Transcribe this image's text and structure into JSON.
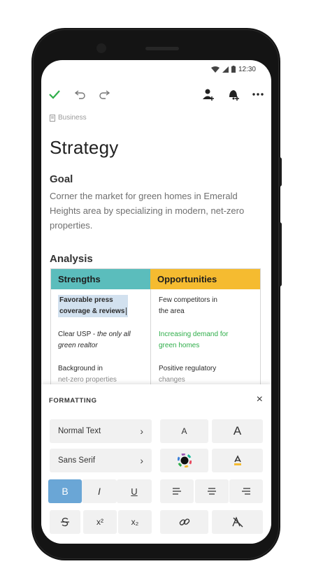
{
  "status": {
    "time": "12:30"
  },
  "toolbar": {
    "done": "done-check",
    "undo": "undo-arrow",
    "redo": "redo-arrow",
    "share": "add-person",
    "notify": "bell-plus",
    "more": "more-dots"
  },
  "note": {
    "breadcrumb": "Business",
    "title": "Strategy",
    "goal_heading": "Goal",
    "goal_text": "Corner the market for green homes in Emerald Heights area by specializing in modern, net-zero properties.",
    "analysis_heading": "Analysis"
  },
  "table": {
    "headers": [
      "Strengths",
      "Opportunities"
    ],
    "strengths": [
      {
        "line1": "Favorable press",
        "line2": "coverage & reviews"
      },
      {
        "line1a": "Clear USP - ",
        "line1b": "the only all",
        "line2": "green realtor"
      },
      {
        "line1": "Background in",
        "line2": "net-zero properties"
      }
    ],
    "opportunities": [
      {
        "line1": "Few competitors in",
        "line2": "the area"
      },
      {
        "line1": "Increasing demand for",
        "line2": "green homes"
      },
      {
        "line1": "Positive regulatory",
        "line2": "changes"
      }
    ],
    "colors": {
      "strengths": "#5bbdbc",
      "opportunities": "#f5bb30",
      "highlight": "#d2e1ef",
      "green_text": "#2fae4a"
    }
  },
  "formatting": {
    "title": "FORMATTING",
    "close": "×",
    "style_label": "Normal Text",
    "font_label": "Sans Serif",
    "small_a": "A",
    "large_a": "A",
    "bold": "B",
    "italic": "I",
    "underline": "U",
    "superscript": "x²",
    "subscript": "x₂",
    "active_color": "#6aa6d6"
  }
}
